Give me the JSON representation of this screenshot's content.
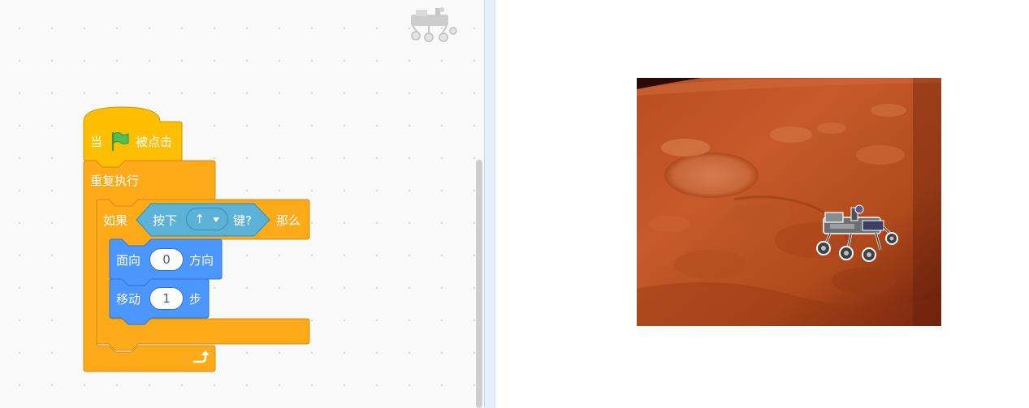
{
  "blocks": {
    "hat": {
      "when": "当",
      "clicked": "被点击",
      "flag_icon": "green-flag-icon"
    },
    "forever": {
      "label": "重复执行",
      "loop_icon": "loop-arrow-icon"
    },
    "if_block": {
      "if_label": "如果",
      "then_label": "那么"
    },
    "key_pressed": {
      "press_label": "按下",
      "key_value": "↑",
      "key_label": "键?",
      "dropdown_icon": "caret-down-icon"
    },
    "point_direction": {
      "label": "面向",
      "value": "0",
      "suffix": "方向"
    },
    "move": {
      "label": "移动",
      "value": "1",
      "suffix": "步"
    }
  },
  "sprites": {
    "corner_sprite_icon": "rover-icon",
    "stage_sprite_icon": "rover-icon"
  },
  "colors": {
    "events": "#ffbf00",
    "control": "#ffab19",
    "motion": "#4c97ff",
    "sensing": "#5cb1d6",
    "stage_surface": "#c8582a"
  }
}
